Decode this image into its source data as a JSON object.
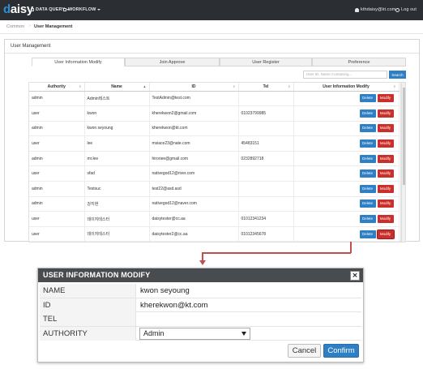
{
  "app": {
    "brand_initial": "d",
    "brand_rest": "aisy",
    "nav": [
      {
        "label": "DATA QUERY"
      },
      {
        "label": "WORKFLOW"
      }
    ],
    "user_email": "kthdaisy@kt.com",
    "logout_label": "Log out"
  },
  "breadcrumb": {
    "parent": "Common",
    "current": "User Management"
  },
  "panel": {
    "title": "User Management",
    "tabs": [
      {
        "label": "User Information Modify",
        "active": true
      },
      {
        "label": "Join Approve",
        "active": false
      },
      {
        "label": "User Register",
        "active": false
      },
      {
        "label": "Preference",
        "active": false
      }
    ],
    "search_placeholder": "User ID, Name Containing...",
    "search_button": "Search"
  },
  "table": {
    "columns": [
      "Authority",
      "Name",
      "ID",
      "Tel",
      "User Information Modify"
    ],
    "delete_label": "Delete",
    "modify_label": "Modify",
    "rows": [
      {
        "authority": "admin",
        "name": "Admin테스트",
        "id": "TestAdmin@test.com",
        "tel": ""
      },
      {
        "authority": "user",
        "name": "kwon",
        "id": "kherekwon2@gmail.com",
        "tel": "01023799985"
      },
      {
        "authority": "admin",
        "name": "kwon seyoung",
        "id": "kherekwon@kt.com",
        "tel": ""
      },
      {
        "authority": "user",
        "name": "lee",
        "id": "msiace23@nate.com",
        "tel": "45483151"
      },
      {
        "authority": "admin",
        "name": "mr.lee",
        "id": "hiroriee@gmail.com",
        "tel": "0232892718"
      },
      {
        "authority": "user",
        "name": "sfad",
        "id": "nativegod12@river.com",
        "tel": ""
      },
      {
        "authority": "admin",
        "name": "Testsuc",
        "id": "test22@asd.asd",
        "tel": ""
      },
      {
        "authority": "admin",
        "name": "강지현",
        "id": "nativegod12@naver.com",
        "tel": ""
      },
      {
        "authority": "user",
        "name": "데이지테스터",
        "id": "daisytester@cc.aa",
        "tel": "01012341234"
      },
      {
        "authority": "user",
        "name": "데이지테스터",
        "id": "daisytester2@cc.aa",
        "tel": "01012345678"
      }
    ]
  },
  "dialog": {
    "title": "USER INFORMATION MODIFY",
    "close_glyph": "×",
    "fields": [
      {
        "label": "NAME",
        "value": "kwon seyoung"
      },
      {
        "label": "ID",
        "value": "kherekwon@kt.com"
      },
      {
        "label": "TEL",
        "value": ""
      },
      {
        "label": "AUTHORITY",
        "value": "Admin"
      }
    ],
    "cancel_label": "Cancel",
    "confirm_label": "Confirm"
  },
  "colors": {
    "navbar": "#2b2f33",
    "primary": "#2f7fc4",
    "danger": "#c9302c",
    "callout": "#c0504d"
  }
}
